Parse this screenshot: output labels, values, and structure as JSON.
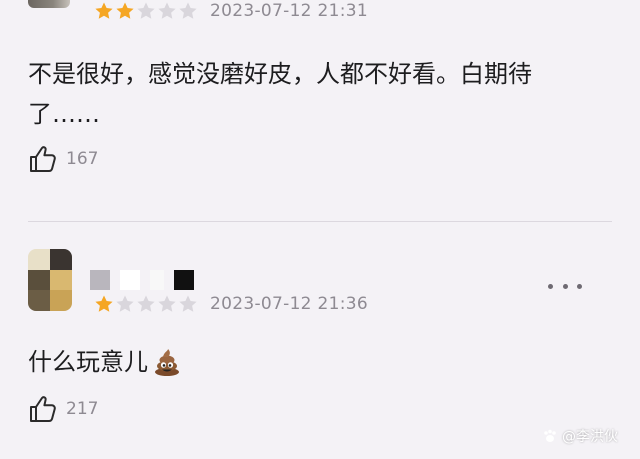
{
  "reviews": [
    {
      "rating": 2,
      "max_rating": 5,
      "date": "2023-07-12 21:31",
      "text_line1": "不是很好，感觉没磨好皮，人都不好看。白期待",
      "text_line2": "了……",
      "likes": "167"
    },
    {
      "rating": 1,
      "max_rating": 5,
      "date": "2023-07-12 21:36",
      "text": "什么玩意儿",
      "text_emoji": "poop-icon",
      "likes": "217"
    }
  ],
  "watermark": {
    "text": "@李洪伙"
  },
  "colors": {
    "background": "#f4f2f6",
    "star_filled": "#f5a623",
    "star_empty": "#d9d6dc",
    "meta_text": "#8e8a92",
    "divider": "#dcd8df"
  },
  "icons": [
    "star-icon",
    "thumbs-up-icon",
    "more-icon",
    "poop-icon"
  ]
}
